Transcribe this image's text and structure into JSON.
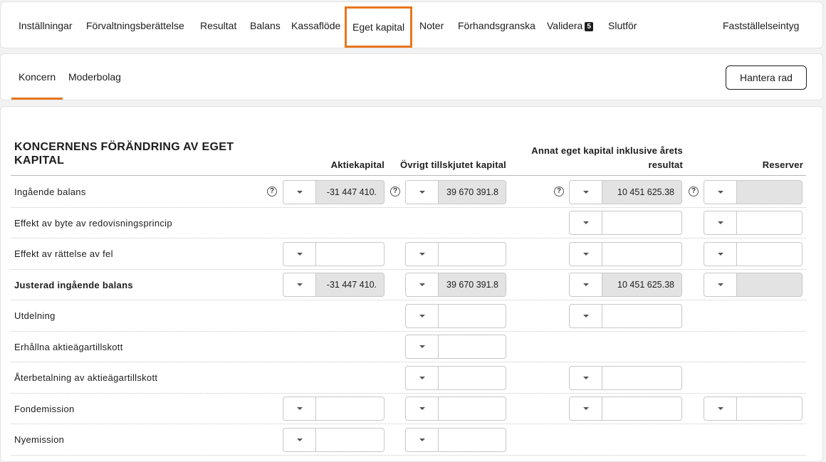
{
  "nav": {
    "items": [
      "Inställningar",
      "Förvaltningsberättelse",
      "Resultat",
      "Balans",
      "Kassaflöde",
      "Eget kapital",
      "Noter",
      "Förhandsgranska",
      "Validera",
      "Slutför",
      "Fastställelseintyg"
    ],
    "validate_badge": "5",
    "active": "Eget kapital"
  },
  "subnav": {
    "tabs": [
      "Koncern",
      "Moderbolag"
    ],
    "active": "Koncern",
    "manage_button": "Hantera rad"
  },
  "table": {
    "title": "KONCERNENS FÖRÄNDRING AV EGET KAPITAL",
    "columns": [
      "Aktiekapital",
      "Övrigt tillskjutet kapital",
      "Annat eget kapital inklusive årets resultat",
      "Reserver"
    ],
    "rows": [
      {
        "label": "Ingående balans",
        "bold": false,
        "cells": [
          "-31 447 410.",
          "39 670 391.8",
          "10 451 625.38",
          ""
        ]
      },
      {
        "label": "Effekt av byte av redovisningsprincip",
        "bold": false,
        "cells": [
          null,
          null,
          "",
          ""
        ]
      },
      {
        "label": "Effekt av rättelse av fel",
        "bold": false,
        "cells": [
          "",
          "",
          "",
          ""
        ]
      },
      {
        "label": "Justerad ingående balans",
        "bold": true,
        "cells": [
          "-31 447 410.",
          "39 670 391.8",
          "10 451 625.38",
          ""
        ]
      },
      {
        "label": "Utdelning",
        "bold": false,
        "cells": [
          null,
          "",
          "",
          null
        ]
      },
      {
        "label": "Erhållna aktieägartillskott",
        "bold": false,
        "cells": [
          null,
          "",
          null,
          null
        ]
      },
      {
        "label": "Återbetalning av aktieägartillskott",
        "bold": false,
        "cells": [
          null,
          "",
          "",
          null
        ]
      },
      {
        "label": "Fondemission",
        "bold": false,
        "cells": [
          "",
          "",
          "",
          ""
        ]
      },
      {
        "label": "Nyemission",
        "bold": false,
        "cells": [
          "",
          "",
          null,
          null
        ]
      }
    ],
    "help_symbol": "?"
  }
}
